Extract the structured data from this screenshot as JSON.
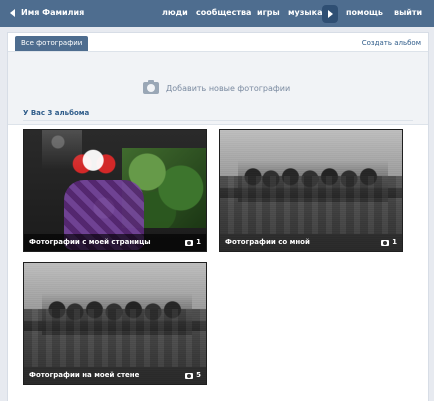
{
  "topbar": {
    "user_name": "Имя Фамилия",
    "nav": [
      "люди",
      "сообщества",
      "игры",
      "музыка",
      "помощь",
      "выйти"
    ]
  },
  "tabs": {
    "active": "Все фотографии",
    "create_album": "Создать альбом"
  },
  "upload": {
    "label": "Добавить новые фотографии",
    "icon": "camera-icon"
  },
  "albums_section": {
    "title": "У Вас 3 альбома",
    "items": [
      {
        "title": "Фотографии с моей страницы",
        "count": "1"
      },
      {
        "title": "Фотографии со мной",
        "count": "1"
      },
      {
        "title": "Фотографии на моей стене",
        "count": "5"
      }
    ]
  },
  "colors": {
    "topbar": "#4e6d8f",
    "link": "#2f5c8a",
    "page_bg": "#e7eaf0"
  }
}
